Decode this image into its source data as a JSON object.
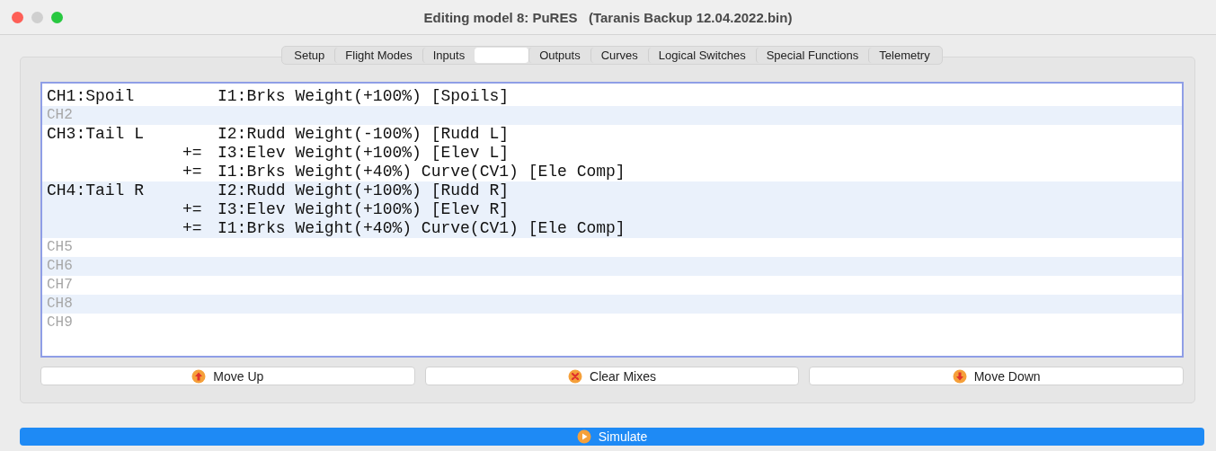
{
  "window": {
    "title": "Editing model 8: PuRES   (Taranis Backup 12.04.2022.bin)"
  },
  "tabs": [
    {
      "label": "Setup",
      "selected": false
    },
    {
      "label": "Flight Modes",
      "selected": false
    },
    {
      "label": "Inputs",
      "selected": false
    },
    {
      "selected": true
    },
    {
      "label": "Outputs",
      "selected": false
    },
    {
      "label": "Curves",
      "selected": false
    },
    {
      "label": "Logical Switches",
      "selected": false
    },
    {
      "label": "Special Functions",
      "selected": false
    },
    {
      "label": "Telemetry",
      "selected": false
    }
  ],
  "channels": [
    {
      "name": "CH1:Spoil",
      "empty": false,
      "lines": [
        {
          "text": "I1:Brks Weight(+100%) [Spoils]"
        }
      ]
    },
    {
      "name": "CH2",
      "empty": true
    },
    {
      "name": "CH3:Tail L",
      "empty": false,
      "lines": [
        {
          "text": "I2:Rudd Weight(-100%) [Rudd L]"
        },
        {
          "op": "+=",
          "text": "I3:Elev Weight(+100%) [Elev L]"
        },
        {
          "op": "+=",
          "text": "I1:Brks Weight(+40%) Curve(CV1) [Ele Comp]"
        }
      ]
    },
    {
      "name": "CH4:Tail R",
      "empty": false,
      "lines": [
        {
          "text": "I2:Rudd Weight(+100%) [Rudd R]"
        },
        {
          "op": "+=",
          "text": "I3:Elev Weight(+100%) [Elev R]"
        },
        {
          "op": "+=",
          "text": "I1:Brks Weight(+40%) Curve(CV1) [Ele Comp]"
        }
      ]
    },
    {
      "name": "CH5",
      "empty": true
    },
    {
      "name": "CH6",
      "empty": true
    },
    {
      "name": "CH7",
      "empty": true
    },
    {
      "name": "CH8",
      "empty": true
    },
    {
      "name": "CH9",
      "empty": true
    }
  ],
  "buttons": [
    {
      "kind": "up",
      "label": "Move Up"
    },
    {
      "kind": "clear",
      "label": "Clear Mixes"
    },
    {
      "kind": "down",
      "label": "Move Down"
    }
  ],
  "simulate": {
    "label": "Simulate"
  }
}
